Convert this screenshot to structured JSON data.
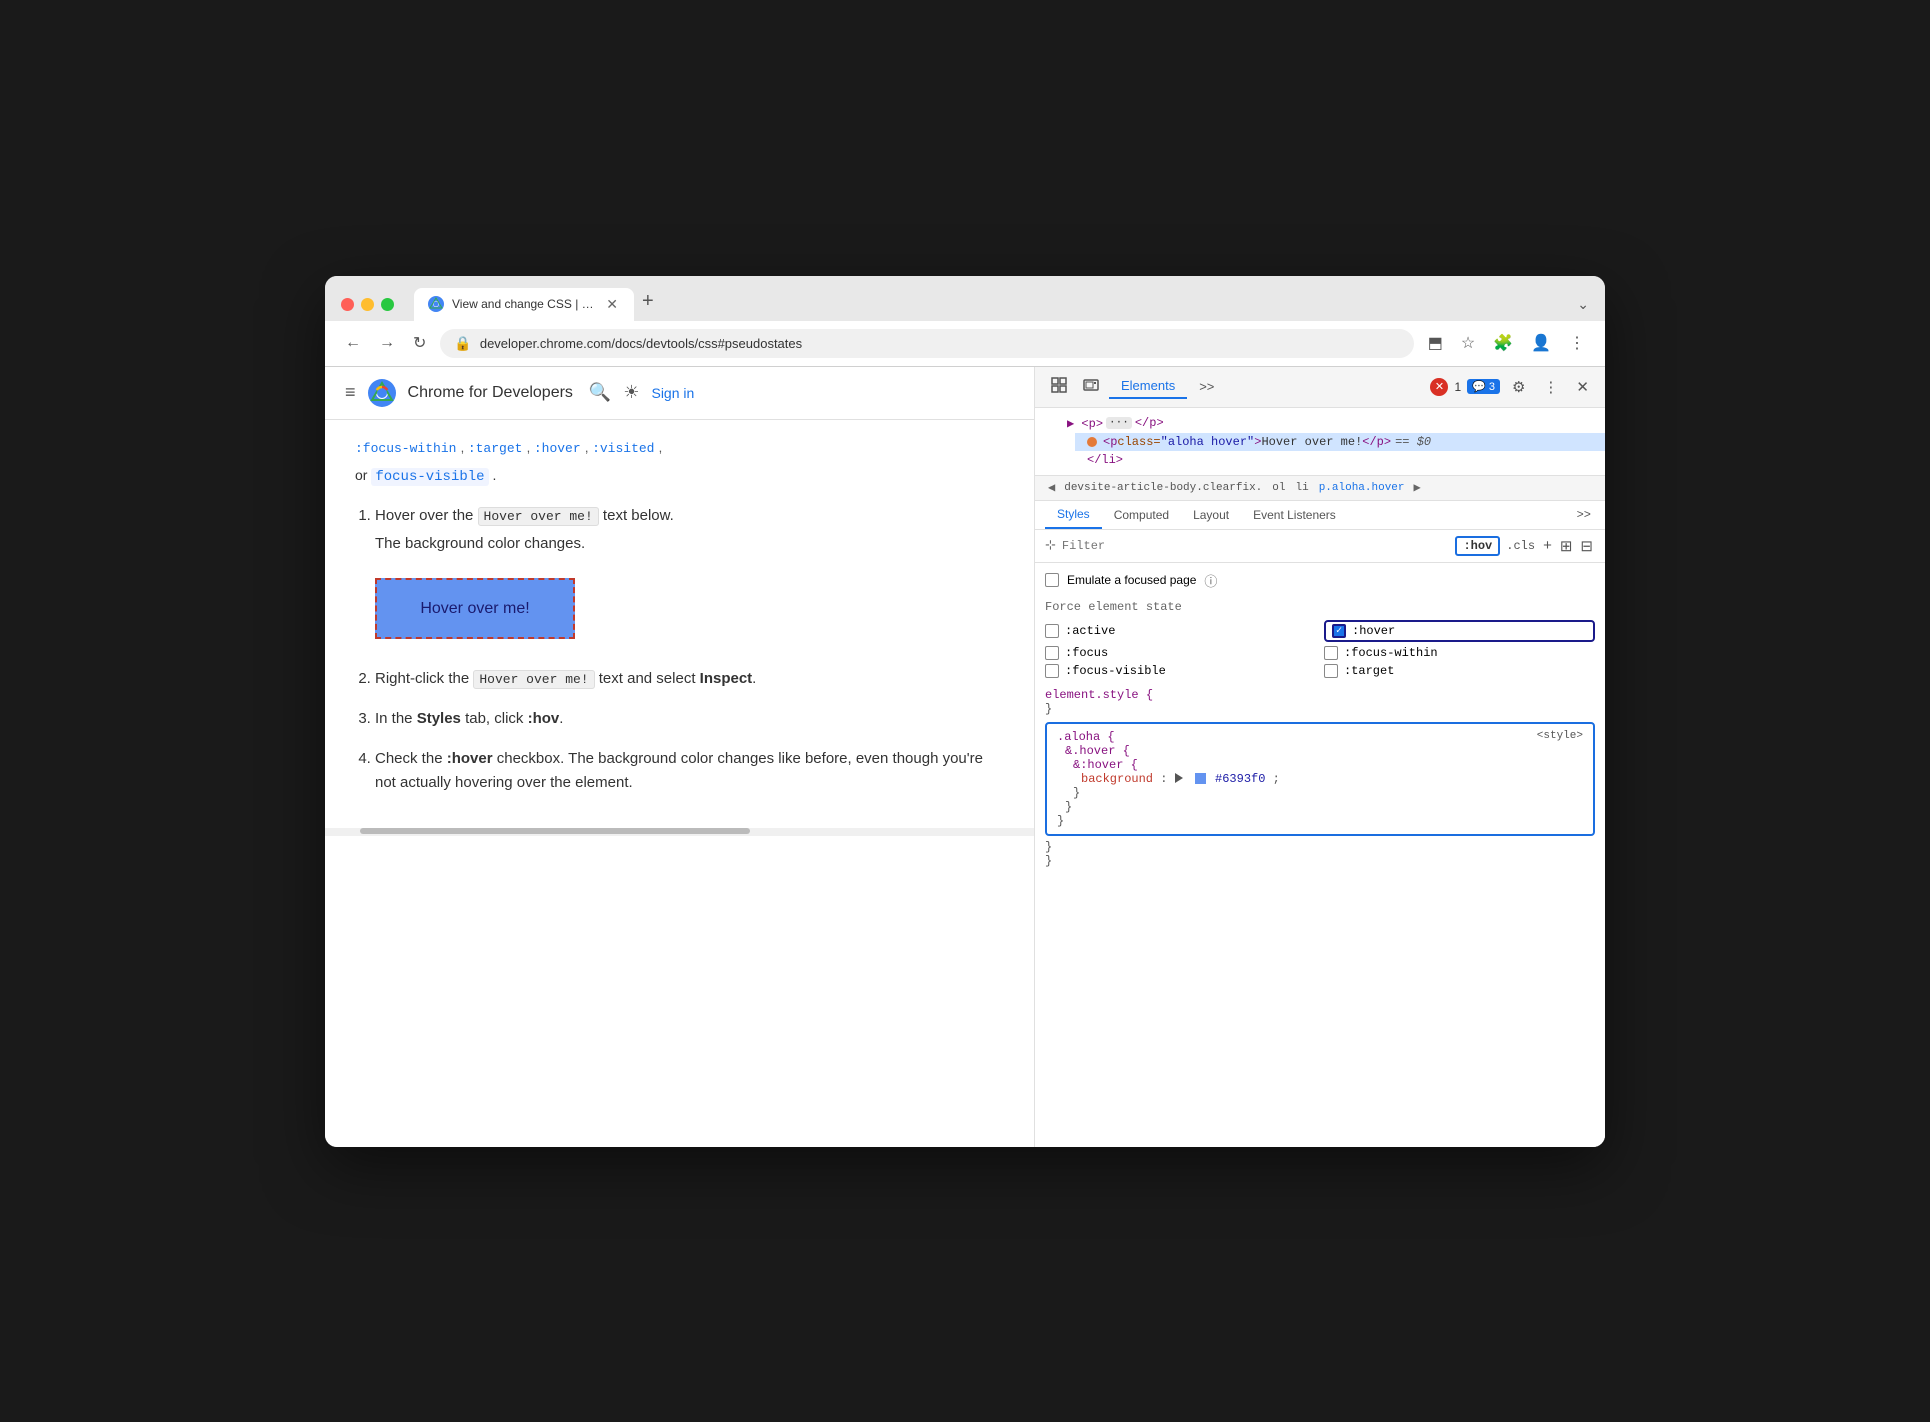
{
  "window": {
    "traffic_lights": [
      "red",
      "yellow",
      "green"
    ],
    "tab": {
      "title": "View and change CSS | Chr…",
      "favicon": "chrome"
    },
    "tab_new_label": "+",
    "tab_expand_label": "⌄"
  },
  "addressbar": {
    "url": "developer.chrome.com/docs/devtools/css#pseudostates",
    "nav_back": "←",
    "nav_forward": "→",
    "nav_refresh": "↻"
  },
  "page": {
    "header": {
      "menu_icon": "≡",
      "site_name": "Chrome for Developers",
      "search_icon": "🔍",
      "theme_icon": "☀",
      "sign_in": "Sign in"
    },
    "article": {
      "links_row": ":focus-within, :target, :hover, :visited,",
      "or_text": "or",
      "focus_visible": "focus-visible",
      "dot": ".",
      "steps": [
        {
          "number": "1.",
          "text_before": "Hover over the",
          "code": "Hover over me!",
          "text_after": "text below. The background color changes."
        },
        {
          "number": "2.",
          "text_before": "Right-click the",
          "code": "Hover over me!",
          "text_after": "text and select",
          "bold": "Inspect",
          "period": "."
        },
        {
          "number": "3.",
          "text_before": "In the",
          "bold_styles": "Styles",
          "text_middle": "tab, click",
          "code_hov": ":hov",
          "period": "."
        },
        {
          "number": "4.",
          "text_before": "Check the",
          "bold_hover": ":hover",
          "text_after": "checkbox. The background color changes like before, even though you're not actually hovering over the element."
        }
      ],
      "hover_button_text": "Hover over me!"
    }
  },
  "devtools": {
    "toolbar": {
      "cursor_icon": "⊹",
      "layout_icon": "▭",
      "tabs": [
        "Elements",
        ">>"
      ],
      "active_tab": "Elements",
      "error_count": "1",
      "warning_count": "3",
      "settings_icon": "⚙",
      "more_icon": "⋮",
      "close_icon": "✕"
    },
    "dom": {
      "lines": [
        {
          "indent": 1,
          "content": "▶ <p> ··· </p>",
          "selected": false
        },
        {
          "indent": 2,
          "content": "<p class=\"aloha hover\">Hover over me!</p> == $0",
          "selected": true,
          "has_dot": true
        },
        {
          "indent": 2,
          "content": "</li>",
          "selected": false
        }
      ]
    },
    "breadcrumb": {
      "items": [
        {
          "label": "devsite-article-body.clearfix.",
          "active": false
        },
        {
          "label": "ol",
          "active": false
        },
        {
          "label": "li",
          "active": false
        },
        {
          "label": "p.aloha.hover",
          "active": true
        }
      ]
    },
    "styles_tabs": [
      "Styles",
      "Computed",
      "Layout",
      "Event Listeners",
      ">>"
    ],
    "active_styles_tab": "Styles",
    "filter": {
      "placeholder": "Filter",
      "hov_badge": ":hov",
      "cls_label": ".cls"
    },
    "emulate": {
      "label": "Emulate a focused page",
      "checked": false
    },
    "force_state": {
      "label": "Force element state",
      "states": [
        {
          "id": "active",
          "label": ":active",
          "checked": false,
          "col": 1
        },
        {
          "id": "hover",
          "label": ":hover",
          "checked": true,
          "col": 2
        },
        {
          "id": "focus",
          "label": ":focus",
          "checked": false,
          "col": 1
        },
        {
          "id": "focus-within",
          "label": ":focus-within",
          "checked": false,
          "col": 2
        },
        {
          "id": "focus-visible",
          "label": ":focus-visible",
          "checked": false,
          "col": 1
        },
        {
          "id": "target",
          "label": ":target",
          "checked": false,
          "col": 2
        }
      ]
    },
    "css_rules": [
      {
        "selector": "element.style {",
        "close": "}"
      },
      {
        "source": "<style>",
        "selector_lines": [
          ".aloha {",
          "  &.hover {",
          "    &:hover {",
          "      background: #6393f0;",
          "    }",
          "  }",
          "}"
        ],
        "highlighted": true
      }
    ]
  }
}
